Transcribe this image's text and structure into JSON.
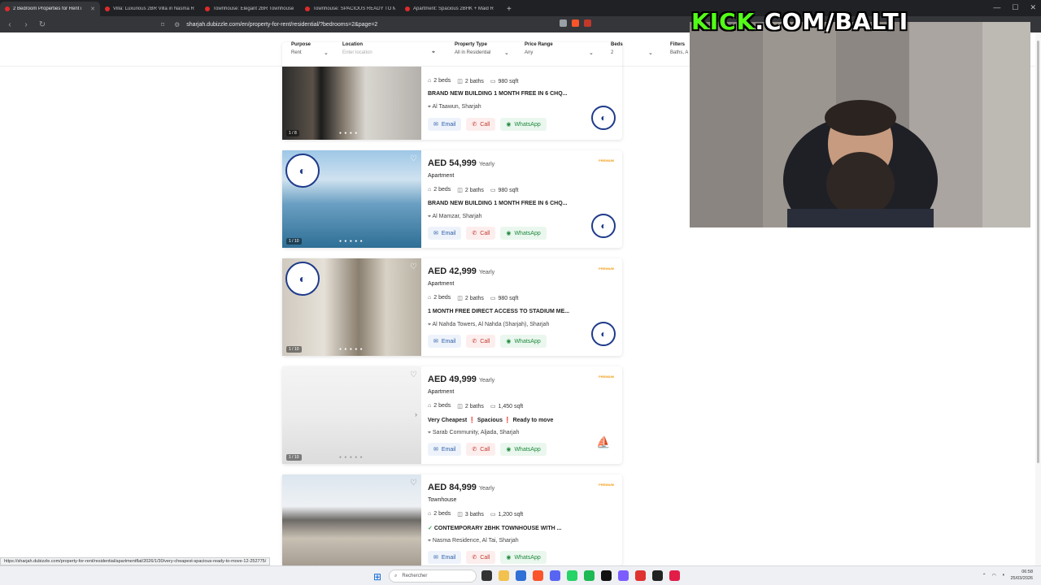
{
  "browser": {
    "tabs": [
      {
        "title": "2 Bedroom Properties for Rent i"
      },
      {
        "title": "Villa: Luxurious 2BR Villa in Nasma R"
      },
      {
        "title": "Townhouse: Elegant 2BR Townhouse"
      },
      {
        "title": "Townhouse: SPACIOUS READY TO M"
      },
      {
        "title": "Apartment: Spacious 2BHK + Maid R"
      }
    ],
    "url": "sharjah.dubizzle.com/en/property-for-rent/residential/?bedrooms=2&page=2"
  },
  "filters": {
    "purpose": {
      "label": "Purpose",
      "value": "Rent"
    },
    "location": {
      "label": "Location",
      "placeholder": "Enter location"
    },
    "property_type": {
      "label": "Property Type",
      "value": "All in Residential"
    },
    "price_range": {
      "label": "Price Range",
      "value": "Any"
    },
    "beds": {
      "label": "Beds",
      "value": "2"
    },
    "filters": {
      "label": "Filters",
      "value": "Baths, A"
    }
  },
  "listings": [
    {
      "price": "",
      "period": "",
      "type": "",
      "beds": "2 beds",
      "baths": "2 baths",
      "area": "980 sqft",
      "title": "BRAND NEW BUILDING 1 MONTH FREE IN 6 CHQ...",
      "location": "Al Taawun, Sharjah",
      "counter": "1 / 8"
    },
    {
      "price": "AED 54,999",
      "period": "Yearly",
      "type": "Apartment",
      "beds": "2 beds",
      "baths": "2 baths",
      "area": "980 sqft",
      "title": "BRAND NEW BUILDING 1 MONTH FREE IN 6 CHQ...",
      "location": "Al Mamzar, Sharjah",
      "counter": "1 / 10",
      "badge": "PREMIUM"
    },
    {
      "price": "AED 42,999",
      "period": "Yearly",
      "type": "Apartment",
      "beds": "2 beds",
      "baths": "2 baths",
      "area": "980 sqft",
      "title": "1 MONTH FREE DIRECT ACCESS TO STADIUM ME...",
      "location": "Al Nahda Towers, Al Nahda (Sharjah), Sharjah",
      "counter": "1 / 10",
      "badge": "PREMIUM"
    },
    {
      "price": "AED 49,999",
      "period": "Yearly",
      "type": "Apartment",
      "beds": "2 beds",
      "baths": "2 baths",
      "area": "1,450 sqft",
      "title": "Very Cheapest  ❗ Spacious  ❗ Ready to move",
      "location": "Sarab Community, Aljada, Sharjah",
      "counter": "1 / 10",
      "badge": "PREMIUM"
    },
    {
      "price": "AED 84,999",
      "period": "Yearly",
      "type": "Townhouse",
      "beds": "2 beds",
      "baths": "3 baths",
      "area": "1,200 sqft",
      "title": "CONTEMPORARY 2BHK TOWNHOUSE WITH ...",
      "location": "Nasma Residence, Al Tai, Sharjah",
      "counter": "",
      "badge": "PREMIUM"
    }
  ],
  "actions": {
    "email": "Email",
    "call": "Call",
    "whatsapp": "WhatsApp"
  },
  "overlay": {
    "kick": "KICK",
    "rest": ".COM/BALTI"
  },
  "status_url": "https://sharjah.dubizzle.com/property-for-rent/residential/apartmentflat/2026/1/30/very-cheapest-spacious-ready-to-move-12-252775/",
  "taskbar": {
    "search_placeholder": "Rechercher",
    "time": "06:58",
    "date": "25/03/2026"
  }
}
